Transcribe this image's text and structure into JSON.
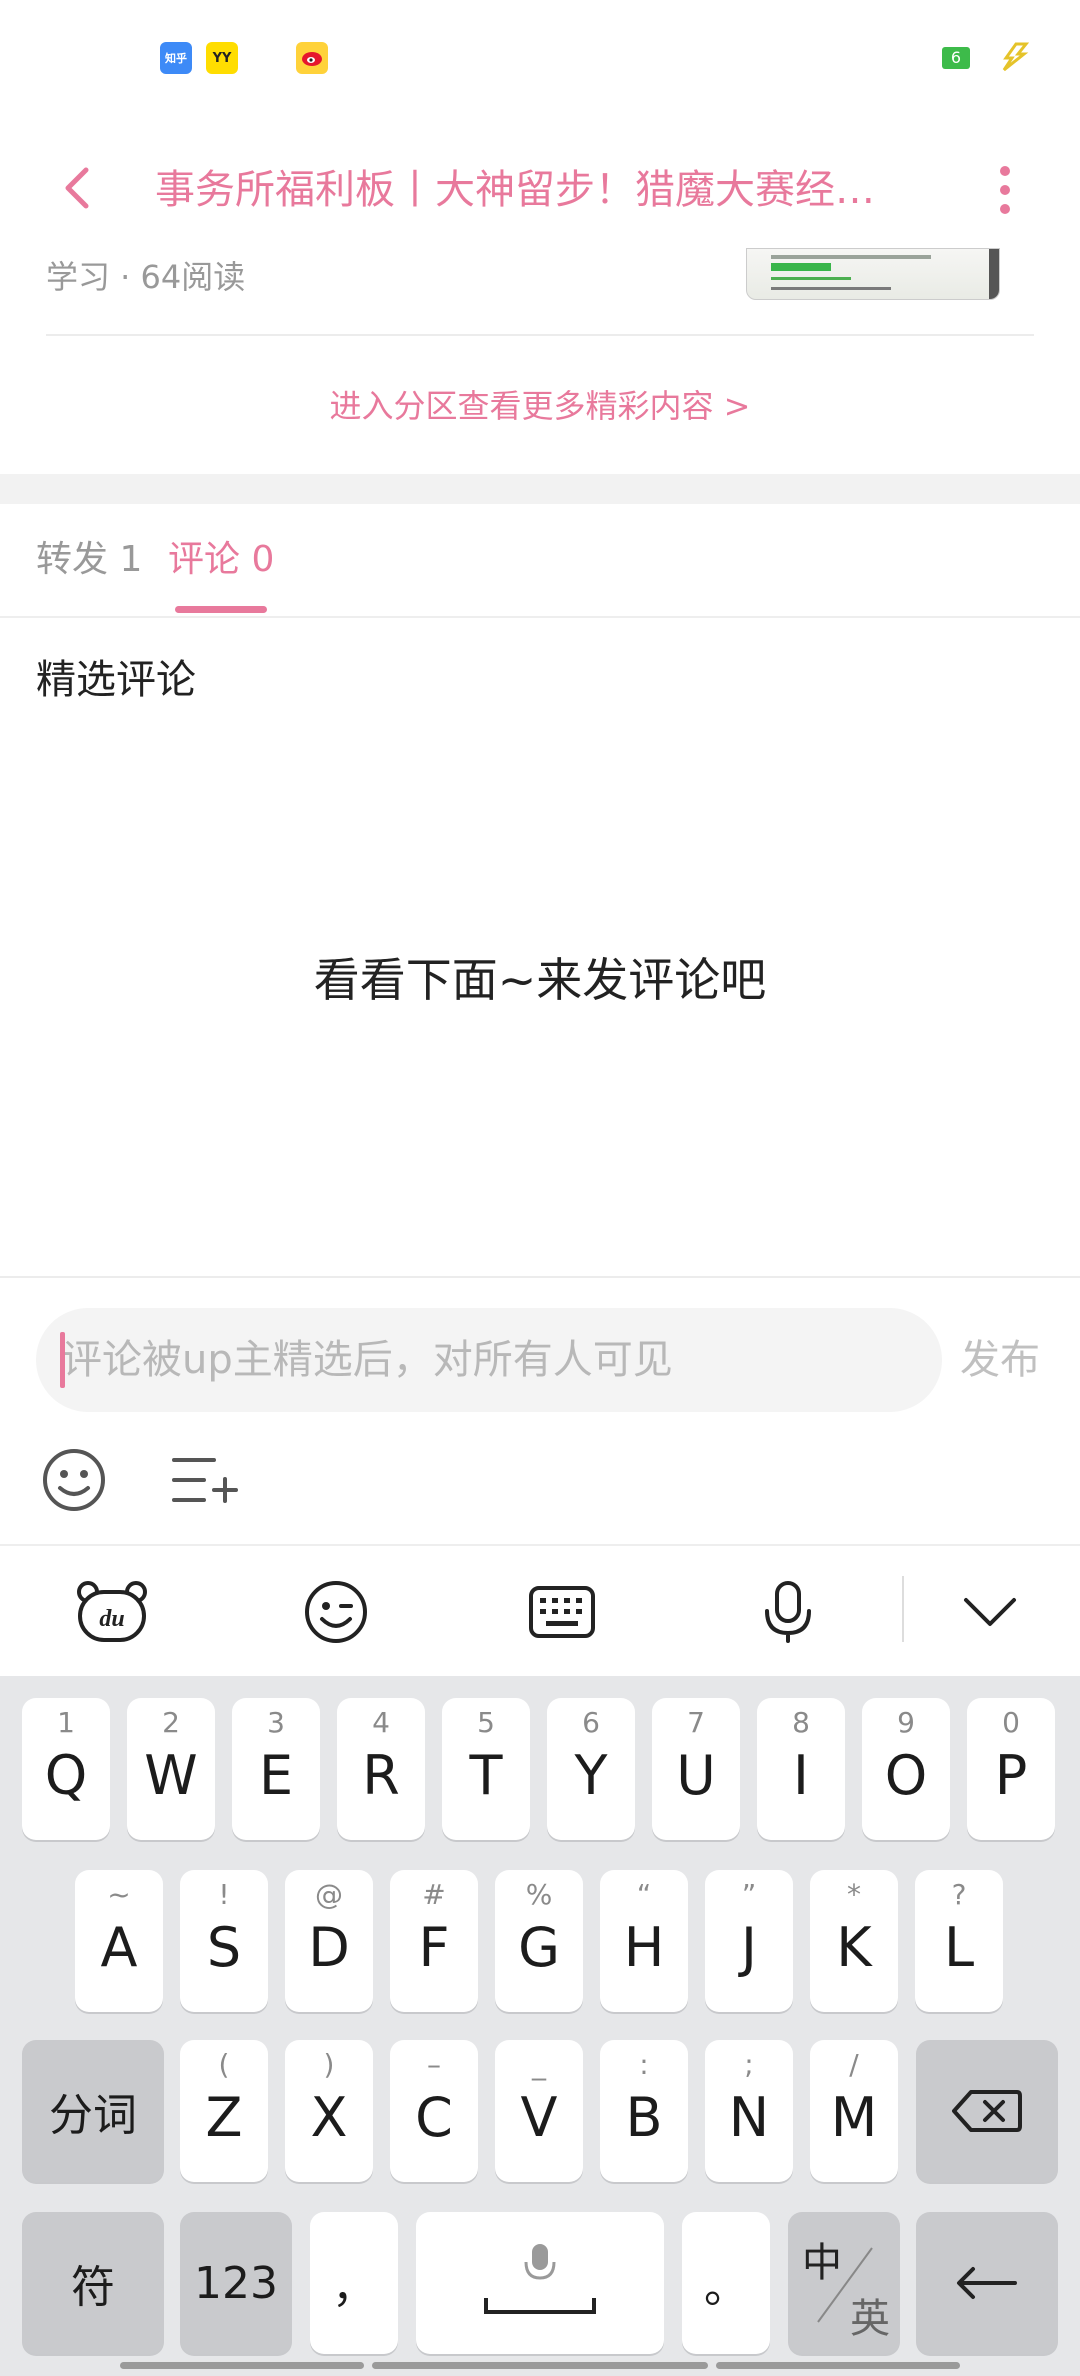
{
  "status_bar": {
    "apps": [
      {
        "name": "zhihu",
        "text": "知乎",
        "color": "#3d8af7"
      },
      {
        "name": "yy",
        "text": "YY",
        "color": "#ffdd00"
      },
      {
        "name": "weibo",
        "text": "",
        "color": "#e6162d"
      }
    ],
    "battery_text": "6"
  },
  "header": {
    "title": "事务所福利板丨大神留步！猎魔大赛经…"
  },
  "article": {
    "meta": "学习 · 64阅读",
    "more_link": "进入分区查看更多精彩内容 >"
  },
  "tabs": [
    {
      "label": "转发 1"
    },
    {
      "label": "评论 0"
    }
  ],
  "comments": {
    "section_title": "精选评论",
    "empty_text": "看看下面~来发评论吧"
  },
  "composer": {
    "placeholder": "评论被up主精选后，对所有人可见",
    "publish_label": "发布"
  },
  "keyboard": {
    "row1": [
      {
        "k": "Q",
        "h": "1"
      },
      {
        "k": "W",
        "h": "2"
      },
      {
        "k": "E",
        "h": "3"
      },
      {
        "k": "R",
        "h": "4"
      },
      {
        "k": "T",
        "h": "5"
      },
      {
        "k": "Y",
        "h": "6"
      },
      {
        "k": "U",
        "h": "7"
      },
      {
        "k": "I",
        "h": "8"
      },
      {
        "k": "O",
        "h": "9"
      },
      {
        "k": "P",
        "h": "0"
      }
    ],
    "row2": [
      {
        "k": "A",
        "h": "~"
      },
      {
        "k": "S",
        "h": "!"
      },
      {
        "k": "D",
        "h": "@"
      },
      {
        "k": "F",
        "h": "#"
      },
      {
        "k": "G",
        "h": "%"
      },
      {
        "k": "H",
        "h": "“"
      },
      {
        "k": "J",
        "h": "”"
      },
      {
        "k": "K",
        "h": "*"
      },
      {
        "k": "L",
        "h": "?"
      }
    ],
    "row3": [
      {
        "k": "Z",
        "h": "("
      },
      {
        "k": "X",
        "h": ")"
      },
      {
        "k": "C",
        "h": "–"
      },
      {
        "k": "V",
        "h": "_"
      },
      {
        "k": "B",
        "h": ":"
      },
      {
        "k": "N",
        "h": ";"
      },
      {
        "k": "M",
        "h": "/"
      }
    ],
    "segment_label": "分词",
    "symbol_label": "符",
    "numeric_label": "123",
    "comma_label": "，",
    "period_label": "。",
    "lang_zh": "中",
    "lang_en": "英"
  },
  "colors": {
    "accent": "#e8799c"
  }
}
